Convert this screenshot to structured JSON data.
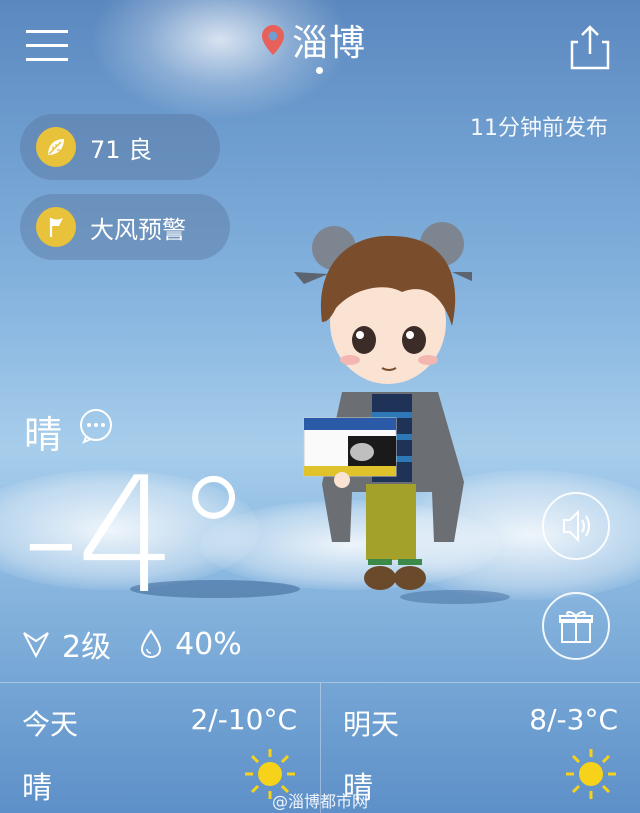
{
  "header": {
    "city": "淄博",
    "publish_time": "11分钟前发布"
  },
  "badges": {
    "aqi": {
      "value": "71",
      "level": "良",
      "label": "71 良"
    },
    "warning": {
      "label": "大风预警"
    }
  },
  "current": {
    "condition": "晴",
    "temperature": "-4°",
    "wind": "2级",
    "humidity": "40%"
  },
  "forecast": [
    {
      "day": "今天",
      "range": "2/-10°C",
      "condition": "晴",
      "icon": "sun-icon"
    },
    {
      "day": "明天",
      "range": "8/-3°C",
      "condition": "晴",
      "icon": "sun-icon"
    }
  ],
  "watermark": "@淄博都市网",
  "colors": {
    "accent_yellow": "#e8c23a",
    "pin_red": "#e8605a",
    "sun_yellow": "#f7d21a"
  }
}
